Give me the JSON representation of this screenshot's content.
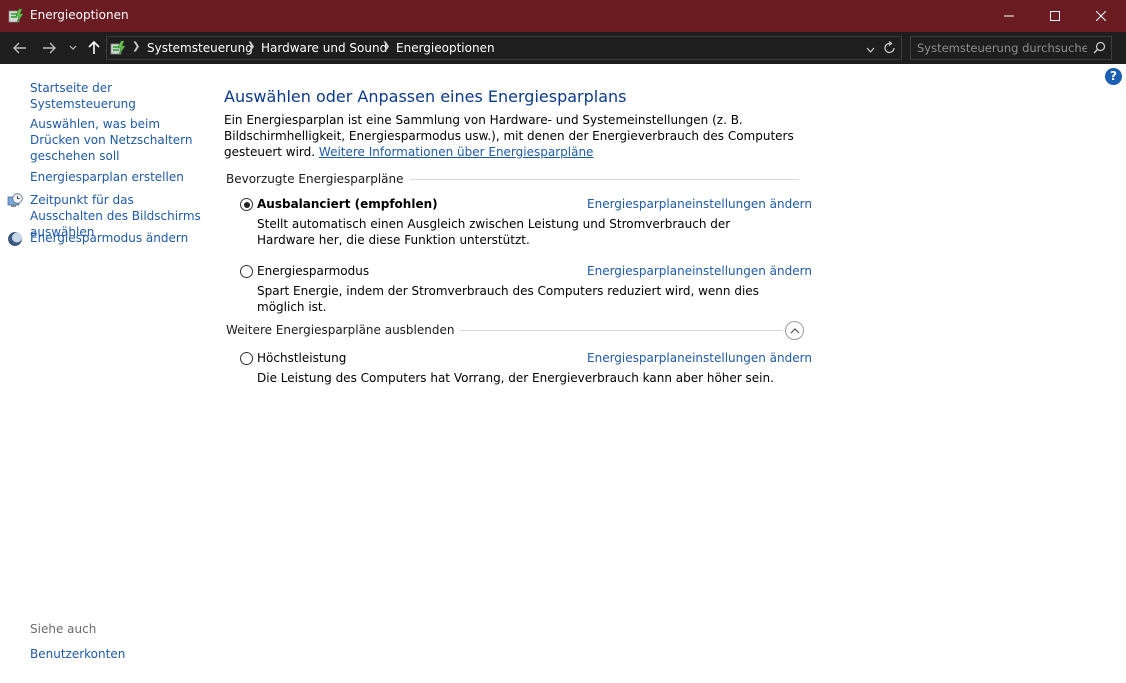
{
  "window": {
    "title": "Energieoptionen",
    "accent_color": "#6b1c22"
  },
  "address_bar": {
    "breadcrumbs": [
      "Systemsteuerung",
      "Hardware und Sound",
      "Energieoptionen"
    ],
    "search_placeholder": "Systemsteuerung durchsuchen"
  },
  "left_nav": {
    "links": [
      "Startseite der Systemsteuerung",
      "Auswählen, was beim Drücken von Netzschaltern geschehen soll",
      "Energiesparplan erstellen",
      "Zeitpunkt für das Ausschalten des Bildschirms auswählen",
      "Energiesparmodus ändern"
    ],
    "see_also_label": "Siehe auch",
    "see_also_links": [
      "Benutzerkonten"
    ]
  },
  "main": {
    "help_label": "?",
    "heading": "Auswählen oder Anpassen eines Energiesparplans",
    "intro_text": "Ein Energiesparplan ist eine Sammlung von Hardware- und Systemeinstellungen (z. B. Bildschirmhelligkeit, Energiesparmodus usw.), mit denen der Energieverbrauch des Computers gesteuert wird. ",
    "intro_link": "Weitere Informationen über Energiesparpläne",
    "preferred_section_title": "Bevorzugte Energiesparpläne",
    "hidden_section_title": "Weitere Energiesparpläne ausblenden",
    "plans": [
      {
        "name": "Ausbalanciert (empfohlen)",
        "selected": true,
        "link": "Energiesparplaneinstellungen ändern",
        "description": "Stellt automatisch einen Ausgleich zwischen Leistung und Stromverbrauch der Hardware her, die diese Funktion unterstützt."
      },
      {
        "name": "Energiesparmodus",
        "selected": false,
        "link": "Energiesparplaneinstellungen ändern",
        "description": "Spart Energie, indem der Stromverbrauch des Computers reduziert wird, wenn dies möglich ist."
      },
      {
        "name": "Höchstleistung",
        "selected": false,
        "link": "Energiesparplaneinstellungen ändern",
        "description": "Die Leistung des Computers hat Vorrang, der Energieverbrauch kann aber höher sein."
      }
    ]
  }
}
